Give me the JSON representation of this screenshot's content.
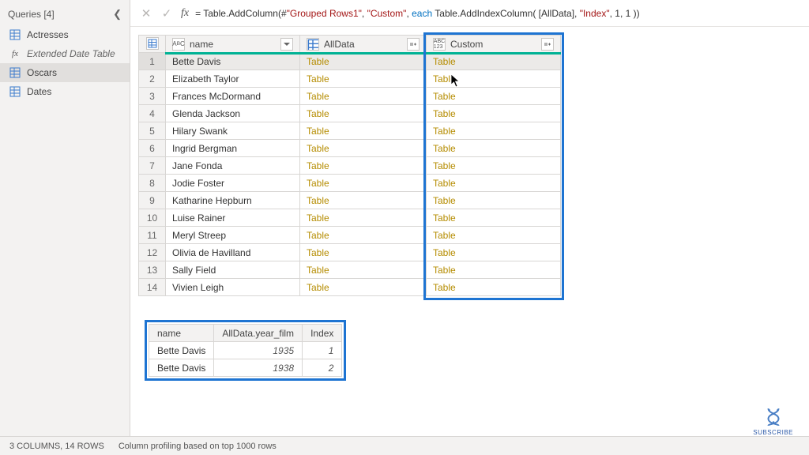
{
  "sidebar": {
    "title": "Queries [4]",
    "items": [
      {
        "label": "Actresses",
        "icon": "table"
      },
      {
        "label": "Extended Date Table",
        "icon": "fx",
        "italic": true
      },
      {
        "label": "Oscars",
        "icon": "table",
        "selected": true
      },
      {
        "label": "Dates",
        "icon": "table"
      }
    ]
  },
  "formula": {
    "prefix": "= ",
    "parts": [
      {
        "t": "fn",
        "v": "Table.AddColumn"
      },
      {
        "t": "pn",
        "v": "("
      },
      {
        "t": "fn",
        "v": "#"
      },
      {
        "t": "str",
        "v": "\"Grouped Rows1\""
      },
      {
        "t": "pn",
        "v": ", "
      },
      {
        "t": "str",
        "v": "\"Custom\""
      },
      {
        "t": "pn",
        "v": ", "
      },
      {
        "t": "kw",
        "v": "each"
      },
      {
        "t": "pn",
        "v": " "
      },
      {
        "t": "fn",
        "v": "Table.AddIndexColumn"
      },
      {
        "t": "pn",
        "v": "( [AllData], "
      },
      {
        "t": "str",
        "v": "\"Index\""
      },
      {
        "t": "pn",
        "v": ", "
      },
      {
        "t": "num",
        "v": "1"
      },
      {
        "t": "pn",
        "v": ", "
      },
      {
        "t": "num",
        "v": "1"
      },
      {
        "t": "pn",
        "v": " ))"
      }
    ]
  },
  "grid": {
    "columns": [
      {
        "key": "rownum",
        "type": "rownum"
      },
      {
        "key": "name",
        "label": "name",
        "type": "text"
      },
      {
        "key": "alldata",
        "label": "AllData",
        "type": "table"
      },
      {
        "key": "custom",
        "label": "Custom",
        "type": "any",
        "highlighted": true
      }
    ],
    "rows": [
      {
        "n": 1,
        "name": "Bette Davis",
        "alldata": "Table",
        "custom": "Table",
        "selected": true
      },
      {
        "n": 2,
        "name": "Elizabeth Taylor",
        "alldata": "Table",
        "custom": "Table"
      },
      {
        "n": 3,
        "name": "Frances McDormand",
        "alldata": "Table",
        "custom": "Table"
      },
      {
        "n": 4,
        "name": "Glenda Jackson",
        "alldata": "Table",
        "custom": "Table"
      },
      {
        "n": 5,
        "name": "Hilary Swank",
        "alldata": "Table",
        "custom": "Table"
      },
      {
        "n": 6,
        "name": "Ingrid Bergman",
        "alldata": "Table",
        "custom": "Table"
      },
      {
        "n": 7,
        "name": "Jane Fonda",
        "alldata": "Table",
        "custom": "Table"
      },
      {
        "n": 8,
        "name": "Jodie Foster",
        "alldata": "Table",
        "custom": "Table"
      },
      {
        "n": 9,
        "name": "Katharine Hepburn",
        "alldata": "Table",
        "custom": "Table"
      },
      {
        "n": 10,
        "name": "Luise Rainer",
        "alldata": "Table",
        "custom": "Table"
      },
      {
        "n": 11,
        "name": "Meryl Streep",
        "alldata": "Table",
        "custom": "Table"
      },
      {
        "n": 12,
        "name": "Olivia de Havilland",
        "alldata": "Table",
        "custom": "Table"
      },
      {
        "n": 13,
        "name": "Sally Field",
        "alldata": "Table",
        "custom": "Table"
      },
      {
        "n": 14,
        "name": "Vivien Leigh",
        "alldata": "Table",
        "custom": "Table"
      }
    ]
  },
  "preview": {
    "columns": [
      "name",
      "AllData.year_film",
      "Index"
    ],
    "rows": [
      {
        "name": "Bette Davis",
        "year": "1935",
        "index": "1"
      },
      {
        "name": "Bette Davis",
        "year": "1938",
        "index": "2"
      }
    ]
  },
  "status": {
    "columns_rows": "3 COLUMNS, 14 ROWS",
    "profiling": "Column profiling based on top 1000 rows"
  },
  "subscribe": "SUBSCRIBE"
}
